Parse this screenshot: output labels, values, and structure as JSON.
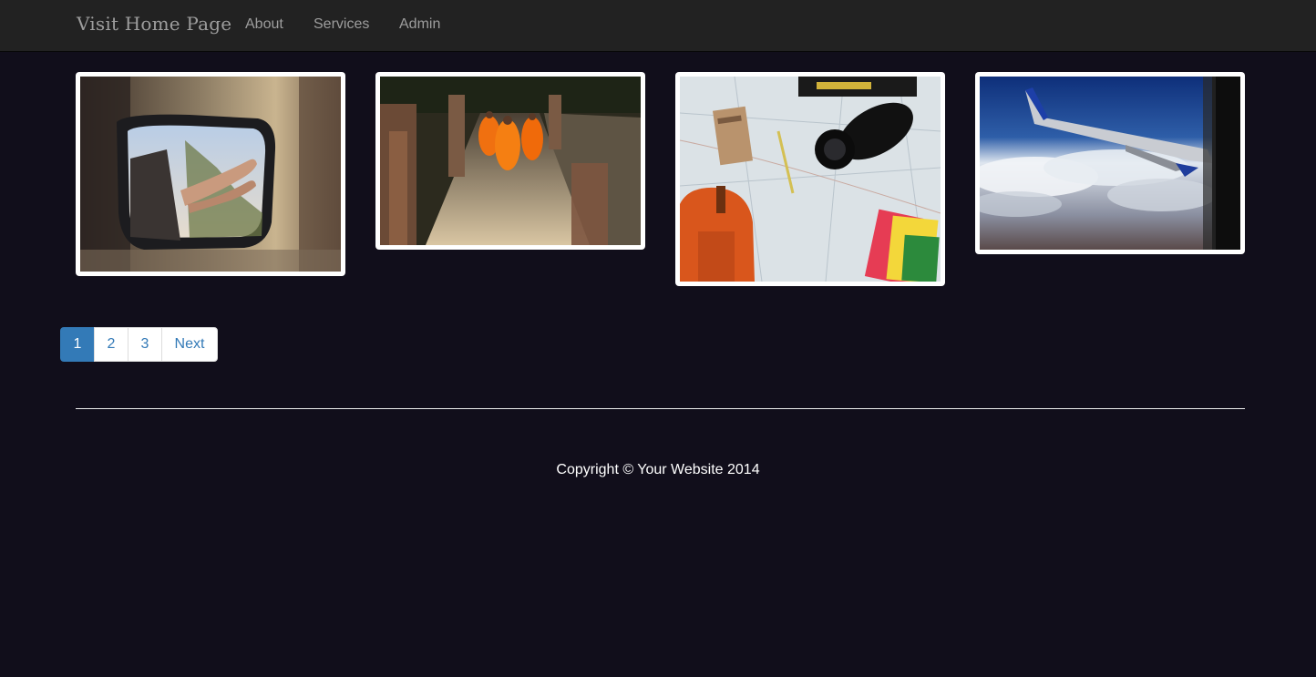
{
  "navbar": {
    "brand": "Visit Home Page",
    "links": [
      {
        "label": "About"
      },
      {
        "label": "Services"
      },
      {
        "label": "Admin"
      }
    ]
  },
  "gallery": {
    "photos": [
      {
        "subject": "side mirror with feet out of car window"
      },
      {
        "subject": "monks in orange robes walking on stone path"
      },
      {
        "subject": "map with camera, notebook and orange backpack"
      },
      {
        "subject": "airplane wing above clouds"
      }
    ]
  },
  "pagination": {
    "pages": [
      "1",
      "2",
      "3"
    ],
    "active": "1",
    "next_label": "Next"
  },
  "footer": {
    "copyright": "Copyright © Your Website 2014"
  },
  "colors": {
    "background": "#110e1b",
    "navbar": "#222222",
    "nav_text": "#9d9d9d",
    "accent": "#337ab7"
  }
}
